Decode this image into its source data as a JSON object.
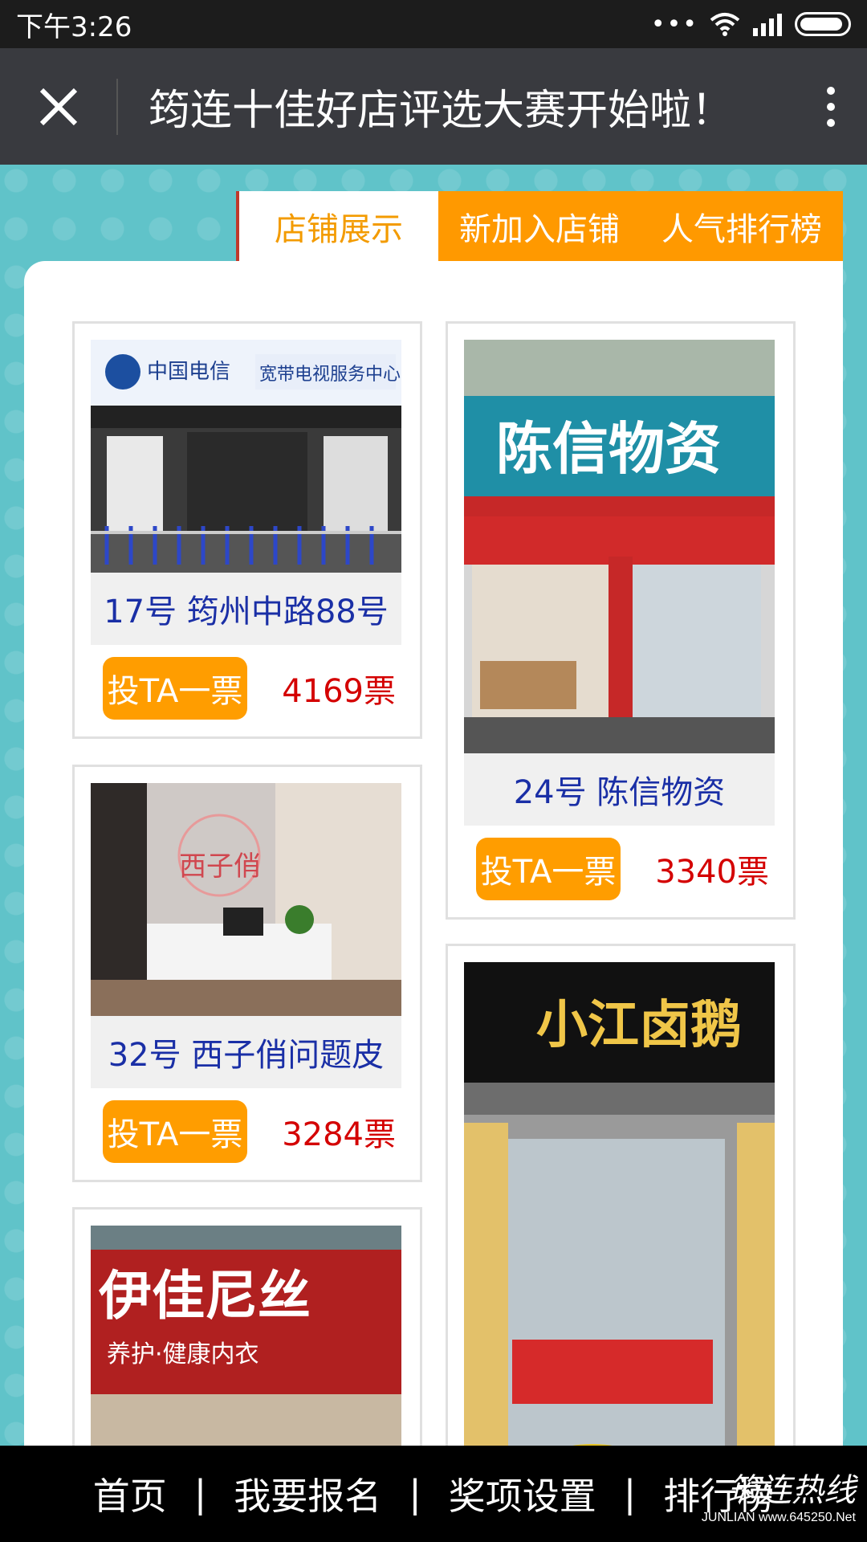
{
  "status_bar": {
    "time": "下午3:26",
    "dots": "•••"
  },
  "header": {
    "title": "筠连十佳好店评选大赛开始啦！",
    "close_icon": "close-icon",
    "menu_icon": "more-vertical-icon"
  },
  "tabs": [
    {
      "label": "店铺展示",
      "active": true
    },
    {
      "label": "新加入店铺",
      "active": false
    },
    {
      "label": "人气排行榜",
      "active": false
    }
  ],
  "cards": [
    {
      "caption": "17号 筠州中路88号",
      "vote_label": "投TA一票",
      "votes": "4169票",
      "sign": "中国电信 宽带电视服务中心"
    },
    {
      "caption": "24号 陈信物资",
      "vote_label": "投TA一票",
      "votes": "3340票",
      "sign": "陈信物资"
    },
    {
      "caption": "32号 西子俏问题皮",
      "vote_label": "投TA一票",
      "votes": "3284票",
      "sign": "西子俏"
    },
    {
      "sign": "伊佳尼丝"
    },
    {
      "sign": "小江卤鹅"
    }
  ],
  "bottom_nav": {
    "items": [
      "首页",
      "我要报名",
      "奖项设置",
      "排行榜"
    ],
    "separator": "|"
  },
  "watermark": {
    "text": "筠连热线",
    "url": "www.645250.Net",
    "sub": "JUNLIAN"
  },
  "colors": {
    "accent": "#ff9d00",
    "vote_count": "#d40000",
    "caption": "#1a2fa6",
    "background": "#5fc3c9"
  }
}
